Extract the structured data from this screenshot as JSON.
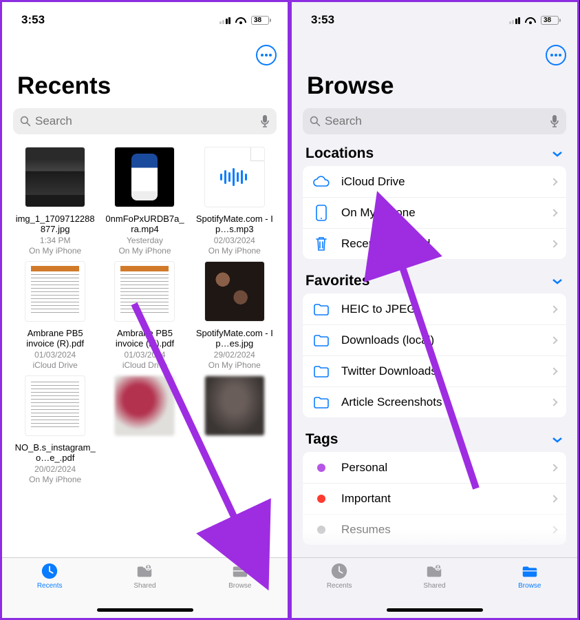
{
  "status": {
    "time": "3:53",
    "battery_pct": "38"
  },
  "left": {
    "title": "Recents",
    "search_placeholder": "Search",
    "files": [
      {
        "name": "img_1_1709712288877.jpg",
        "date": "1:34 PM",
        "loc": "On My iPhone"
      },
      {
        "name": "0nmFoPxURDB7a_ra.mp4",
        "date": "Yesterday",
        "loc": "On My iPhone"
      },
      {
        "name": "SpotifyMate.com - I p…s.mp3",
        "date": "02/03/2024",
        "loc": "On My iPhone"
      },
      {
        "name": "Ambrane PB5 invoice (R).pdf",
        "date": "01/03/2024",
        "loc": "iCloud Drive"
      },
      {
        "name": "Ambrane PB5 invoice (M).pdf",
        "date": "01/03/2024",
        "loc": "iCloud Drive"
      },
      {
        "name": "SpotifyMate.com - I p…es.jpg",
        "date": "29/02/2024",
        "loc": "On My iPhone"
      },
      {
        "name": "NO_B.s_instagram_o…e_.pdf",
        "date": "20/02/2024",
        "loc": "On My iPhone"
      }
    ],
    "tabs": {
      "recents": "Recents",
      "shared": "Shared",
      "browse": "Browse"
    }
  },
  "right": {
    "title": "Browse",
    "search_placeholder": "Search",
    "sections": {
      "locations": {
        "title": "Locations",
        "items": [
          "iCloud Drive",
          "On My iPhone",
          "Recently Deleted"
        ]
      },
      "favorites": {
        "title": "Favorites",
        "items": [
          "HEIC to JPEG",
          "Downloads (local)",
          "Twitter Downloads",
          "Article Screenshots"
        ]
      },
      "tags": {
        "title": "Tags",
        "items": [
          {
            "label": "Personal",
            "color": "#b556e6"
          },
          {
            "label": "Important",
            "color": "#ff3b30"
          },
          {
            "label": "Resumes",
            "color": "#9e9ea3"
          }
        ]
      }
    },
    "tabs": {
      "recents": "Recents",
      "shared": "Shared",
      "browse": "Browse"
    }
  }
}
